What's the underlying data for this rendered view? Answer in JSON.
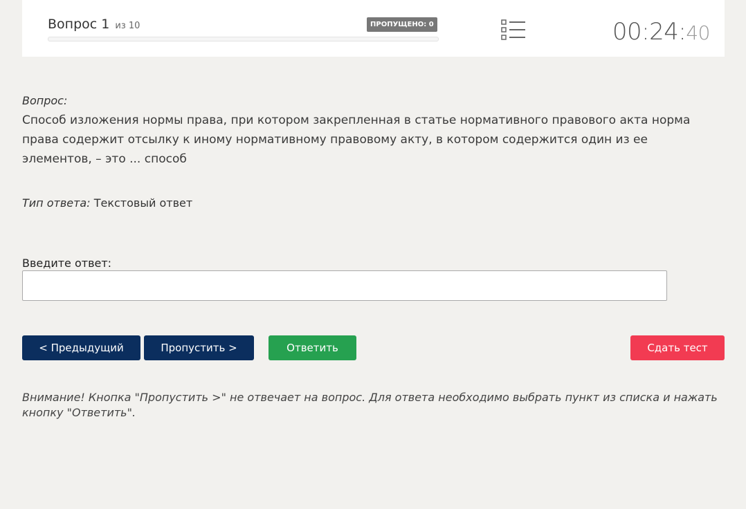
{
  "header": {
    "question_label": "Вопрос",
    "question_number": "1",
    "of_text": "из 10",
    "skipped_badge": "ПРОПУЩЕНО: 0",
    "progress": 0,
    "list_icon": "list-icon",
    "timer": {
      "main": "00:24",
      "sep": ":",
      "seconds": "40"
    }
  },
  "question": {
    "label": "Вопрос:",
    "text": "Способ изложения нормы права, при котором закрепленная в статье нормативного правового акта норма права содержит отсылку к иному нормативному правовому акту, в котором содержится один из ее элементов, – это ... способ"
  },
  "answer_type": {
    "label": "Тип ответа:",
    "value": "Текстовый ответ"
  },
  "answer_input": {
    "label": "Введите ответ:",
    "value": "",
    "placeholder": ""
  },
  "buttons": {
    "prev": "< Предыдущий",
    "skip": "Пропустить >",
    "answer": "Ответить",
    "submit": "Сдать тест"
  },
  "notice": "Внимание! Кнопка \"Пропустить >\" не отвечает на вопрос. Для ответа необходимо выбрать пункт из списка и нажать кнопку \"Ответить\".",
  "colors": {
    "primary": "#0b2e5e",
    "answer": "#26a150",
    "submit": "#f23b52",
    "badge": "#777777",
    "background": "#f2f1ee"
  }
}
